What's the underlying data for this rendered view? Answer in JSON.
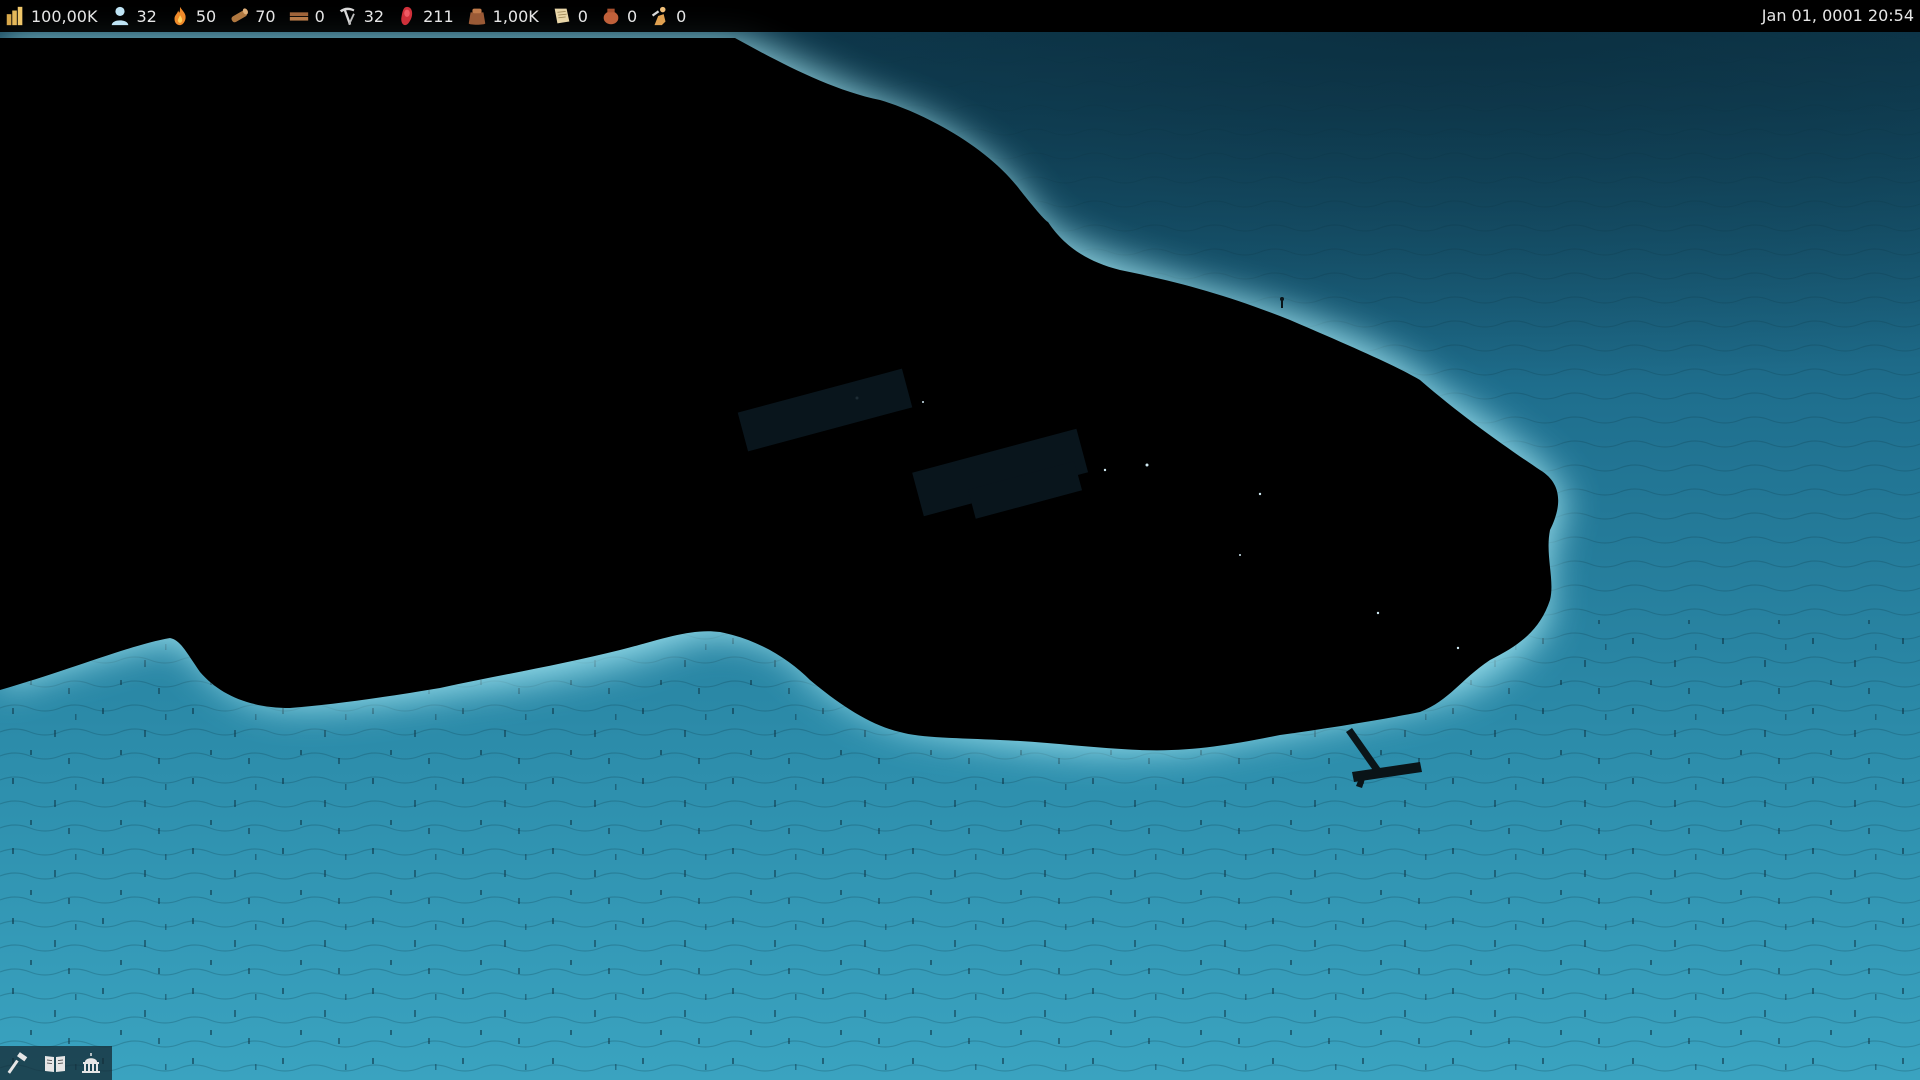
{
  "resources": [
    {
      "id": "money",
      "icon": "gold-coins-icon",
      "value": "100,00K"
    },
    {
      "id": "population",
      "icon": "person-icon",
      "value": "32"
    },
    {
      "id": "firewood",
      "icon": "fire-icon",
      "value": "50"
    },
    {
      "id": "logs",
      "icon": "log-icon",
      "value": "70"
    },
    {
      "id": "planks",
      "icon": "planks-icon",
      "value": "0"
    },
    {
      "id": "tools",
      "icon": "pickaxe-hammer-icon",
      "value": "32"
    },
    {
      "id": "food",
      "icon": "meat-icon",
      "value": "211"
    },
    {
      "id": "supplies",
      "icon": "sack-icon",
      "value": "1,00K"
    },
    {
      "id": "paper",
      "icon": "scroll-icon",
      "value": "0"
    },
    {
      "id": "pottery",
      "icon": "pot-icon",
      "value": "0"
    },
    {
      "id": "workers",
      "icon": "worker-icon",
      "value": "0"
    }
  ],
  "datetime": "Jan 01, 0001 20:54",
  "toolbar": [
    {
      "id": "build",
      "icon": "hammer-icon"
    },
    {
      "id": "codex",
      "icon": "book-icon"
    },
    {
      "id": "government",
      "icon": "capitol-icon"
    }
  ],
  "colors": {
    "water_shallow": "#7fd3e6",
    "water_mid": "#2a93b3",
    "water_deep": "#1d5f7a",
    "land": "#000000",
    "ui_text": "#e6e6e6"
  }
}
